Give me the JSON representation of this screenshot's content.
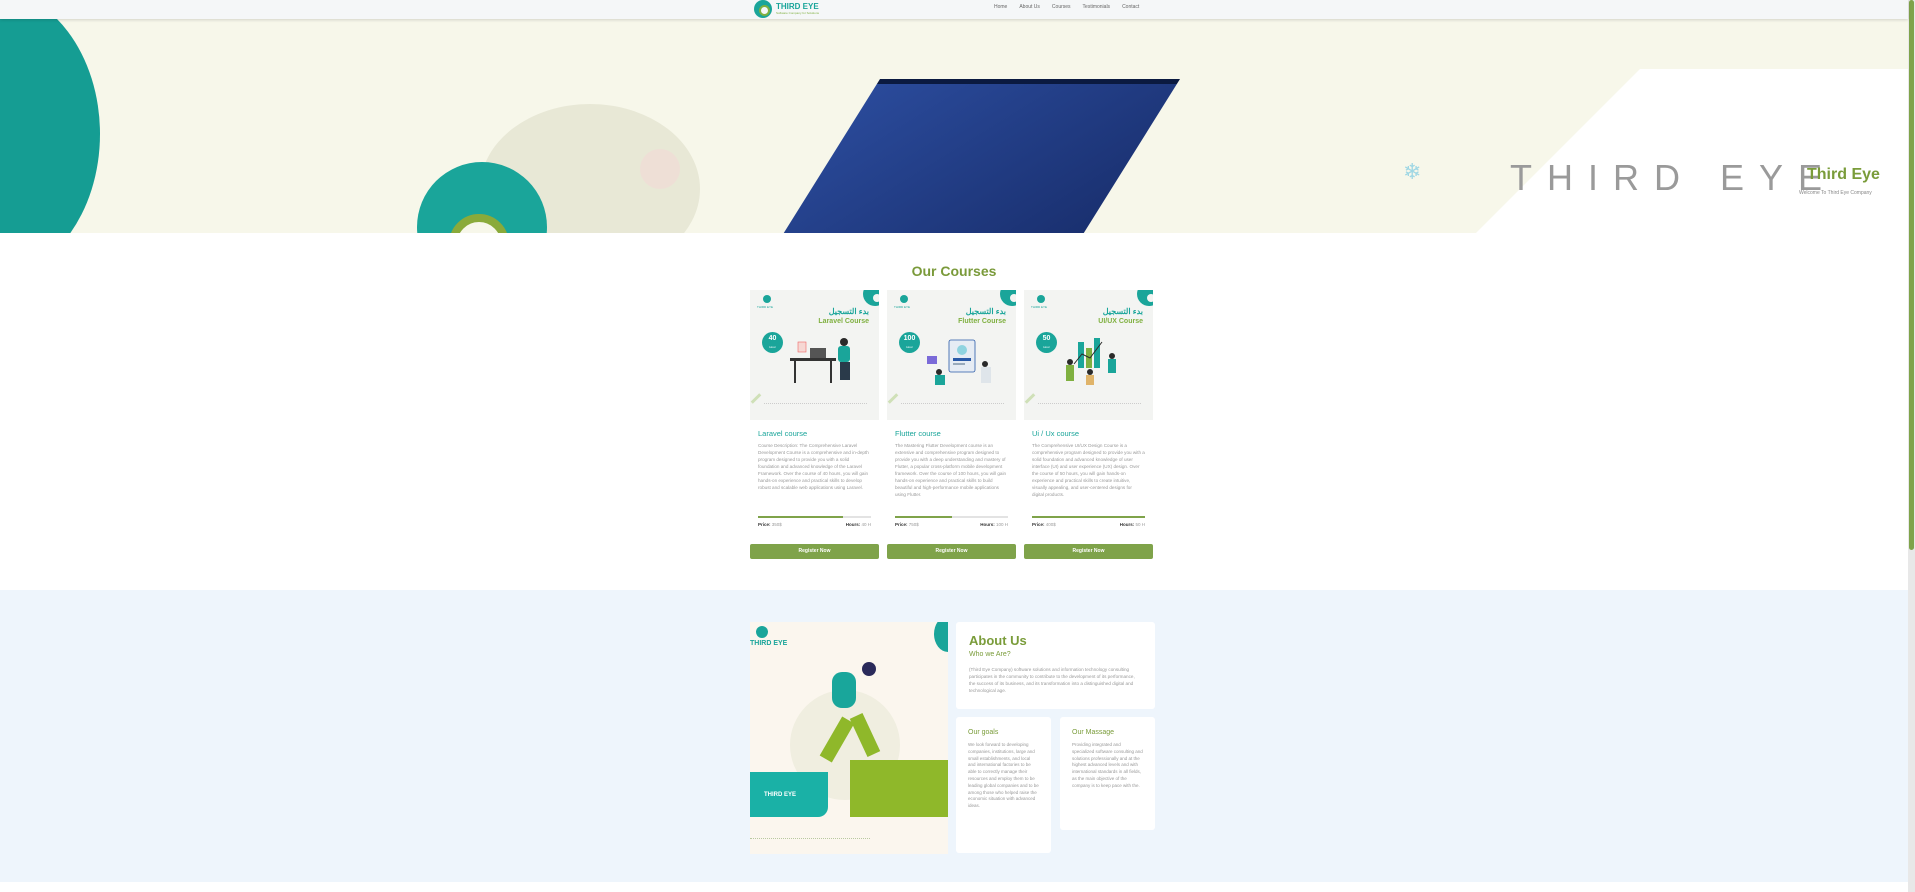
{
  "brand": {
    "name": "THIRD EYE",
    "tagline": "Software Company for Solutions"
  },
  "nav": {
    "items": [
      "Home",
      "About Us",
      "Courses",
      "Testimonials",
      "Contact"
    ]
  },
  "hero": {
    "wordmark": "THIRD EYE",
    "title": "Third Eye",
    "subtitle": "Welcome To Third Eye Company"
  },
  "courses": {
    "section_title": "Our Courses",
    "items": [
      {
        "image_title_ar": "بدء التسجيل",
        "image_title": "Laravel Course",
        "image_badge": "40",
        "image_badge_unit": "Hour",
        "title": "Laravel course",
        "description": "Course Description: The Comprehensive Laravel Development Course is a comprehensive and in-depth program designed to provide you with a solid foundation and advanced knowledge of the Laravel Framework. Over the course of 40 hours, you will gain hands-on experience and practical skills to develop robust and scalable web applications using Laravel.",
        "progress": 0.75,
        "price_label": "Price:",
        "price": "350$",
        "hours_label": "Hours:",
        "hours": "40 H",
        "button": "Register Now"
      },
      {
        "image_title_ar": "بدء التسجيل",
        "image_title": "Flutter Course",
        "image_badge": "100",
        "image_badge_unit": "Hour",
        "title": "Flutter course",
        "description": "The Mastering Flutter Development course is an extensive and comprehensive program designed to provide you with a deep understanding and mastery of Flutter, a popular cross-platform mobile development framework. Over the course of 100 hours, you will gain hands-on experience and practical skills to build beautiful and high-performance mobile applications using Flutter.",
        "progress": 0.5,
        "price_label": "Price:",
        "price": "750$",
        "hours_label": "Hours:",
        "hours": "100 H",
        "button": "Register Now"
      },
      {
        "image_title_ar": "بدء التسجيل",
        "image_title": "UI/UX Course",
        "image_badge": "50",
        "image_badge_unit": "Hour",
        "title": "Ui / Ux course",
        "description": "The Comprehensive UI/UX Design Course is a comprehensive program designed to provide you with a solid foundation and advanced knowledge of user interface (UI) and user experience (UX) design. Over the course of 50 hours, you will gain hands-on experience and practical skills to create intuitive, visually appealing, and user-centered designs for digital products.",
        "progress": 1.0,
        "price_label": "Price:",
        "price": "400$",
        "hours_label": "Hours:",
        "hours": "50 H",
        "button": "Register Now"
      }
    ]
  },
  "about": {
    "title": "About Us",
    "who_title": "Who we Are?",
    "who_text": "(Third Eye Company) software solutions and information technology consulting participates in the community to contribute to the development of its performance, the success of its business, and its transformation into a distinguished digital and technological age.",
    "goals_title": "Our goals",
    "goals_text": "We look forward to developing companies, institutions, large and small establishments, and local and international factories to be able to correctly manage their resources and employ them to be leading global companies and to be among those who helped raise the economic situation with advanced ideas.",
    "message_title": "Our Massage",
    "message_text": "Providing integrated and specialized software consulting and solutions professionally and at the highest advanced levels and with international standards in all fields, as the main objective of the company is to keep pace with the.",
    "image_brand": "THIRD EYE"
  },
  "colors": {
    "teal": "#1aa59a",
    "green": "#7fa34a",
    "about_bg": "#eef5fc"
  }
}
